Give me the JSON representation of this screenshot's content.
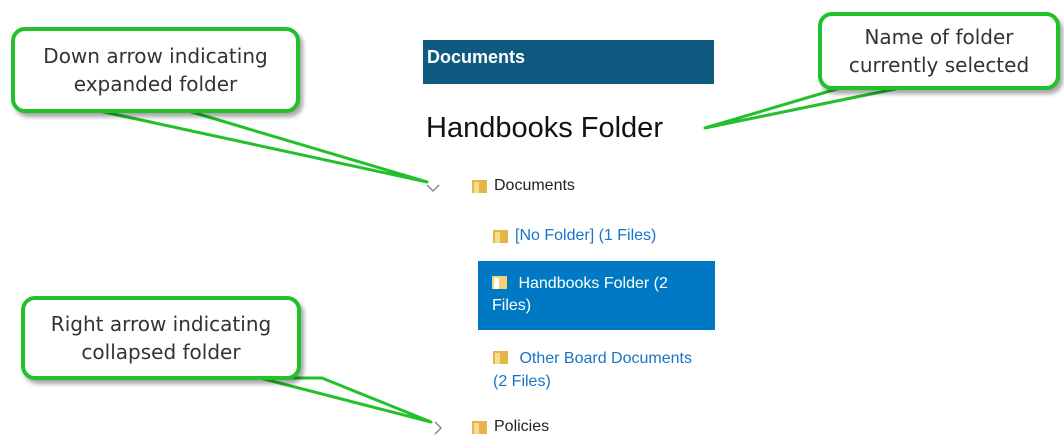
{
  "callouts": {
    "expanded": "Down arrow indicating\nexpanded folder",
    "selected": "Name of folder\ncurrently selected",
    "collapsed": "Right arrow indicating\ncollapsed folder"
  },
  "widget": {
    "header": "Documents",
    "title": "Handbooks Folder"
  },
  "tree": {
    "root": {
      "label": "Documents",
      "expanded": true,
      "icon": "chevron-down-icon"
    },
    "children": [
      {
        "label": "[No Folder] (1 Files)",
        "selected": false
      },
      {
        "label": "Handbooks Folder (2 Files)",
        "selected": true
      },
      {
        "label": "Other Board Documents (2 Files)",
        "selected": false
      }
    ],
    "second_root": {
      "label": "Policies",
      "expanded": false,
      "icon": "chevron-right-icon"
    }
  },
  "colors": {
    "callout_border": "#22c02a",
    "header_bg": "#0e5a80",
    "selected_bg": "#0079c4",
    "link": "#1a73c8"
  }
}
